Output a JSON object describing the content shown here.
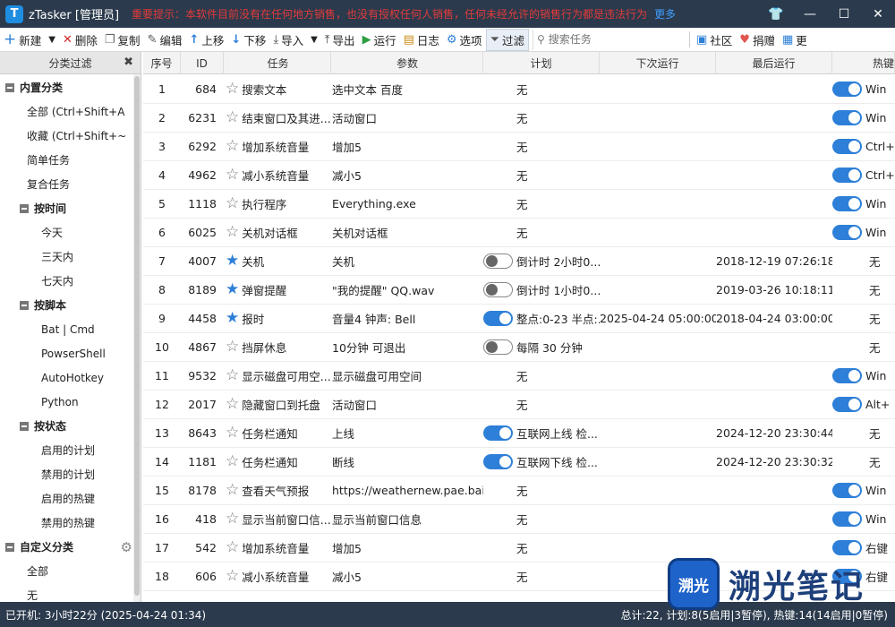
{
  "window": {
    "app_logo": "T",
    "title": "zTasker [管理员]",
    "notice": "重要提示：本软件目前没有在任何地方销售，也没有授权任何人销售，任何未经允许的销售行为都是违法行为",
    "notice_more": "更多",
    "buttons": {
      "skin": "👕",
      "minimize": "—",
      "maximize": "☐",
      "close": "✕"
    }
  },
  "toolbar": {
    "new": "新建",
    "delete": "删除",
    "copy": "复制",
    "edit": "编辑",
    "move_up": "上移",
    "move_down": "下移",
    "import": "导入",
    "export": "导出",
    "run": "运行",
    "log": "日志",
    "options": "选项",
    "filter": "过滤",
    "search_placeholder": "搜索任务",
    "community": "社区",
    "donate": "捐赠",
    "more": "更"
  },
  "sidebar": {
    "header": "分类过滤",
    "items": [
      {
        "label": "内置分类",
        "type": "group",
        "level": 0
      },
      {
        "label": "全部 (Ctrl+Shift+A",
        "type": "item",
        "level": 1
      },
      {
        "label": "收藏 (Ctrl+Shift+~",
        "type": "item",
        "level": 1
      },
      {
        "label": "简单任务",
        "type": "item",
        "level": 1
      },
      {
        "label": "复合任务",
        "type": "item",
        "level": 1
      },
      {
        "label": "按时间",
        "type": "group",
        "level": 1
      },
      {
        "label": "今天",
        "type": "item",
        "level": 2
      },
      {
        "label": "三天内",
        "type": "item",
        "level": 2
      },
      {
        "label": "七天内",
        "type": "item",
        "level": 2
      },
      {
        "label": "按脚本",
        "type": "group",
        "level": 1
      },
      {
        "label": "Bat | Cmd",
        "type": "item",
        "level": 2
      },
      {
        "label": "PowserShell",
        "type": "item",
        "level": 2
      },
      {
        "label": "AutoHotkey",
        "type": "item",
        "level": 2
      },
      {
        "label": "Python",
        "type": "item",
        "level": 2
      },
      {
        "label": "按状态",
        "type": "group",
        "level": 1
      },
      {
        "label": "启用的计划",
        "type": "item",
        "level": 2
      },
      {
        "label": "禁用的计划",
        "type": "item",
        "level": 2
      },
      {
        "label": "启用的热键",
        "type": "item",
        "level": 2
      },
      {
        "label": "禁用的热键",
        "type": "item",
        "level": 2
      },
      {
        "label": "自定义分类",
        "type": "group",
        "level": 0
      },
      {
        "label": "全部",
        "type": "item",
        "level": 1
      },
      {
        "label": "无",
        "type": "item",
        "level": 1
      }
    ]
  },
  "table": {
    "columns": [
      "序号",
      "ID",
      "任务",
      "参数",
      "计划",
      "下次运行",
      "最后运行",
      "热键"
    ],
    "rows": [
      {
        "seq": "1",
        "id": "684",
        "fav": false,
        "task": "搜索文本",
        "param": "选中文本 百度",
        "sched_toggle": "none",
        "sched": "无",
        "next": "",
        "last": "",
        "hot_toggle": "on",
        "hot": "Win"
      },
      {
        "seq": "2",
        "id": "6231",
        "fav": false,
        "task": "结束窗口及其进...",
        "param": "活动窗口",
        "sched_toggle": "none",
        "sched": "无",
        "next": "",
        "last": "",
        "hot_toggle": "on",
        "hot": "Win"
      },
      {
        "seq": "3",
        "id": "6292",
        "fav": false,
        "task": "增加系统音量",
        "param": "增加5",
        "sched_toggle": "none",
        "sched": "无",
        "next": "",
        "last": "",
        "hot_toggle": "on",
        "hot": "Ctrl+"
      },
      {
        "seq": "4",
        "id": "4962",
        "fav": false,
        "task": "减小系统音量",
        "param": "减小5",
        "sched_toggle": "none",
        "sched": "无",
        "next": "",
        "last": "",
        "hot_toggle": "on",
        "hot": "Ctrl+"
      },
      {
        "seq": "5",
        "id": "1118",
        "fav": false,
        "task": "执行程序",
        "param": "Everything.exe",
        "sched_toggle": "none",
        "sched": "无",
        "next": "",
        "last": "",
        "hot_toggle": "on",
        "hot": "Win"
      },
      {
        "seq": "6",
        "id": "6025",
        "fav": false,
        "task": "关机对话框",
        "param": "关机对话框",
        "sched_toggle": "none",
        "sched": "无",
        "next": "",
        "last": "",
        "hot_toggle": "on",
        "hot": "Win"
      },
      {
        "seq": "7",
        "id": "4007",
        "fav": true,
        "task": "关机",
        "param": "关机",
        "sched_toggle": "off",
        "sched": "倒计时 2小时0...",
        "next": "",
        "last": "2018-12-19 07:26:18",
        "hot_toggle": "none",
        "hot": "无"
      },
      {
        "seq": "8",
        "id": "8189",
        "fav": true,
        "task": "弹窗提醒",
        "param": "\"我的提醒\" QQ.wav",
        "sched_toggle": "off",
        "sched": "倒计时 1小时0...",
        "next": "",
        "last": "2019-03-26 10:18:11",
        "hot_toggle": "none",
        "hot": "无"
      },
      {
        "seq": "9",
        "id": "4458",
        "fav": true,
        "task": "报时",
        "param": "音量4 钟声: Bell",
        "sched_toggle": "on",
        "sched": "整点:0-23 半点:...",
        "next": "2025-04-24 05:00:00",
        "last": "2018-04-24 03:00:00",
        "hot_toggle": "none",
        "hot": "无"
      },
      {
        "seq": "10",
        "id": "4867",
        "fav": false,
        "task": "挡屏休息",
        "param": "10分钟 可退出",
        "sched_toggle": "off",
        "sched": "每隔 30 分钟",
        "next": "",
        "last": "",
        "hot_toggle": "none",
        "hot": "无"
      },
      {
        "seq": "11",
        "id": "9532",
        "fav": false,
        "task": "显示磁盘可用空...",
        "param": "显示磁盘可用空间",
        "sched_toggle": "none",
        "sched": "无",
        "next": "",
        "last": "",
        "hot_toggle": "on",
        "hot": "Win"
      },
      {
        "seq": "12",
        "id": "2017",
        "fav": false,
        "task": "隐藏窗口到托盘",
        "param": "活动窗口",
        "sched_toggle": "none",
        "sched": "无",
        "next": "",
        "last": "",
        "hot_toggle": "on",
        "hot": "Alt+"
      },
      {
        "seq": "13",
        "id": "8643",
        "fav": false,
        "task": "任务栏通知",
        "param": "上线",
        "sched_toggle": "on",
        "sched": "互联网上线 检...",
        "next": "",
        "last": "2024-12-20 23:30:44",
        "hot_toggle": "none",
        "hot": "无"
      },
      {
        "seq": "14",
        "id": "1181",
        "fav": false,
        "task": "任务栏通知",
        "param": "断线",
        "sched_toggle": "on",
        "sched": "互联网下线 检...",
        "next": "",
        "last": "2024-12-20 23:30:32",
        "hot_toggle": "none",
        "hot": "无"
      },
      {
        "seq": "15",
        "id": "8178",
        "fav": false,
        "task": "查看天气预报",
        "param": "https://weathernew.pae.bai...",
        "sched_toggle": "none",
        "sched": "无",
        "next": "",
        "last": "",
        "hot_toggle": "on",
        "hot": "Win"
      },
      {
        "seq": "16",
        "id": "418",
        "fav": false,
        "task": "显示当前窗口信...",
        "param": "显示当前窗口信息",
        "sched_toggle": "none",
        "sched": "无",
        "next": "",
        "last": "",
        "hot_toggle": "on",
        "hot": "Win"
      },
      {
        "seq": "17",
        "id": "542",
        "fav": false,
        "task": "增加系统音量",
        "param": "增加5",
        "sched_toggle": "none",
        "sched": "无",
        "next": "",
        "last": "",
        "hot_toggle": "on",
        "hot": "右键"
      },
      {
        "seq": "18",
        "id": "606",
        "fav": false,
        "task": "减小系统音量",
        "param": "减小5",
        "sched_toggle": "none",
        "sched": "无",
        "next": "",
        "last": "",
        "hot_toggle": "on",
        "hot": "右键"
      }
    ]
  },
  "statusbar": {
    "left": "已开机: 3小时22分 (2025-04-24 01:34)",
    "right": "总计:22, 计划:8(5启用|3暂停), 热键:14(14启用|0暂停)"
  },
  "watermark": {
    "logo_text": "溯光",
    "text": "溯光笔记"
  },
  "colors": {
    "titlebar": "#2b3a4c",
    "accent": "#2d7fd8",
    "notice": "#e23b3b"
  }
}
